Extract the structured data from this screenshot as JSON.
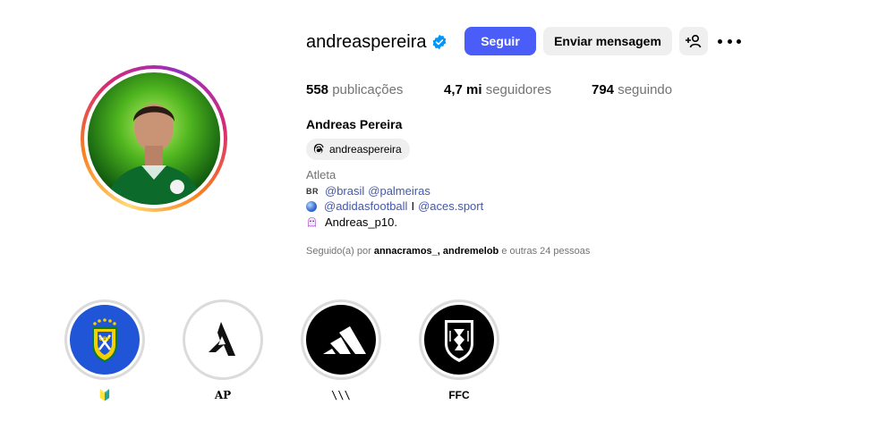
{
  "profile": {
    "username": "andreaspereira",
    "full_name": "Andreas Pereira",
    "threads_handle": "andreaspereira",
    "category": "Atleta",
    "avatar_icon": "profile-photo"
  },
  "actions": {
    "follow_label": "Seguir",
    "message_label": "Enviar mensagem",
    "suggest_icon": "add-person-icon",
    "more_icon": "more-options-icon"
  },
  "stats": {
    "posts_count": "558",
    "posts_label": "publicações",
    "followers_count": "4,7 mi",
    "followers_label": "seguidores",
    "following_count": "794",
    "following_label": "seguindo"
  },
  "bio": {
    "line1_prefix": "BR",
    "line1_links": [
      "@brasil",
      "@palmeiras"
    ],
    "line2_links": [
      "@adidasfootball",
      "@aces.sport"
    ],
    "line2_separator": "I",
    "line3_text": "Andreas_p10."
  },
  "followed_by": {
    "prefix": "Seguido(a) por",
    "users": [
      "annacramos_",
      "andremelob"
    ],
    "suffix": "e outras 24 pessoas"
  },
  "highlights": [
    {
      "label": "🔰",
      "icon": "cbf-crest-icon"
    },
    {
      "label": "AP",
      "icon": "ap-logo-icon"
    },
    {
      "label": "\\\\\\",
      "icon": "adidas-logo-icon"
    },
    {
      "label": "FFC",
      "icon": "fulham-crest-icon"
    }
  ],
  "colors": {
    "accent": "#4a5df9",
    "link": "#4458a8",
    "secondary_text": "#737373",
    "button_bg": "#efefef",
    "verified": "#0095f6"
  }
}
